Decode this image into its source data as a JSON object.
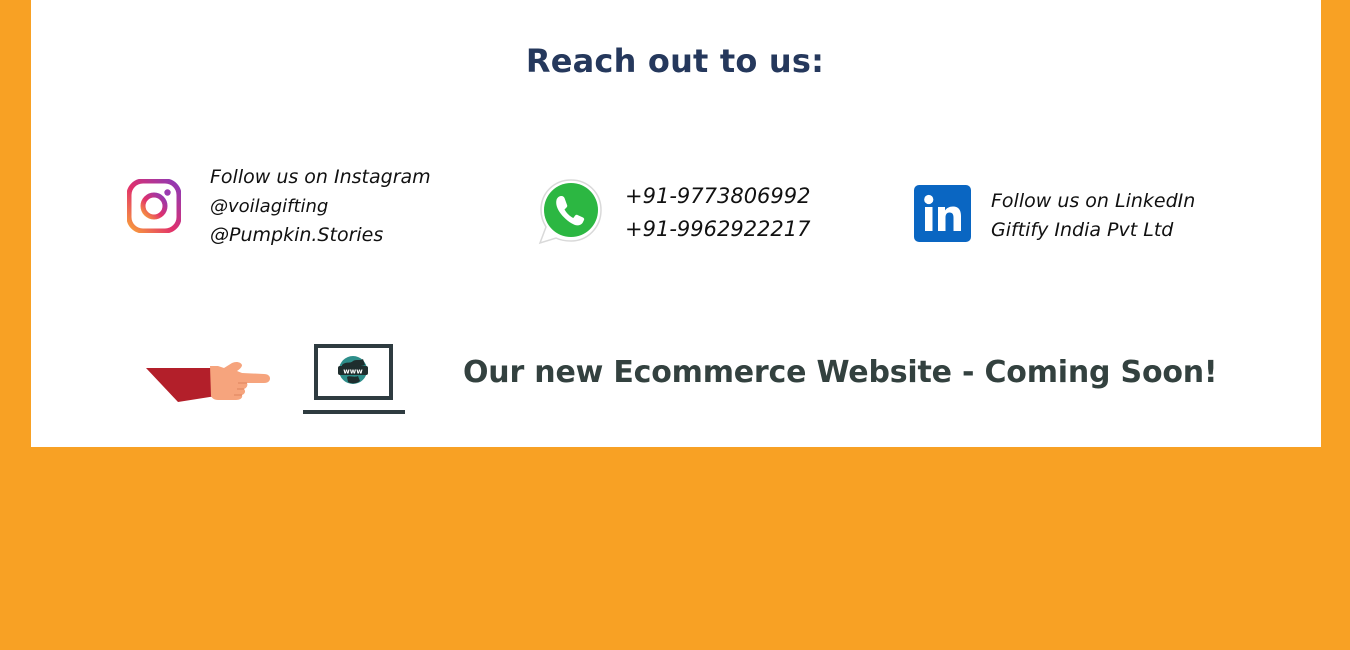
{
  "page": {
    "heading": "Reach out to us:"
  },
  "instagram": {
    "icon": "instagram-icon",
    "title": "Follow us on Instagram",
    "handles": [
      "@voilagifting",
      "@Pumpkin.Stories"
    ]
  },
  "whatsapp": {
    "icon": "whatsapp-icon",
    "phones": [
      "+91-9773806992",
      "+91-9962922217"
    ]
  },
  "linkedin": {
    "icon": "linkedin-icon",
    "title": "Follow us on LinkedIn",
    "company": "Giftify India Pvt Ltd"
  },
  "website": {
    "pointer_icon": "pointing-hand-icon",
    "laptop_icon": "laptop-www-icon",
    "laptop_label": "www",
    "announcement": "Our new Ecommerce Website - Coming Soon!"
  },
  "colors": {
    "background": "#F8A124",
    "card": "#FFFFFF",
    "heading": "#25385C",
    "announcement": "#33413F",
    "linkedin": "#0A66C2",
    "whatsapp": "#2CB742"
  }
}
